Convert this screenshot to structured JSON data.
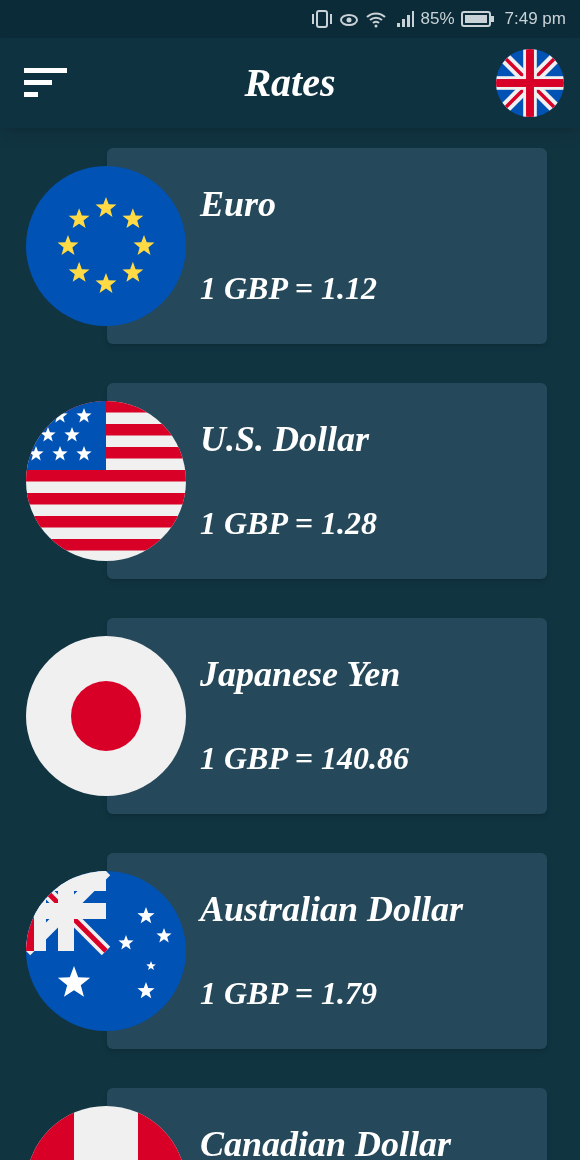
{
  "status_bar": {
    "battery": "85%",
    "time": "7:49 pm"
  },
  "header": {
    "title": "Rates"
  },
  "rates": [
    {
      "kind": "eu",
      "name": "Euro",
      "rate": "1 GBP = 1.12"
    },
    {
      "kind": "us",
      "name": "U.S. Dollar",
      "rate": "1 GBP = 1.28"
    },
    {
      "kind": "jp",
      "name": "Japanese Yen",
      "rate": "1 GBP = 140.86"
    },
    {
      "kind": "au",
      "name": "Australian Dollar",
      "rate": "1 GBP = 1.79"
    },
    {
      "kind": "ca",
      "name": "Canadian Dollar"
    }
  ]
}
